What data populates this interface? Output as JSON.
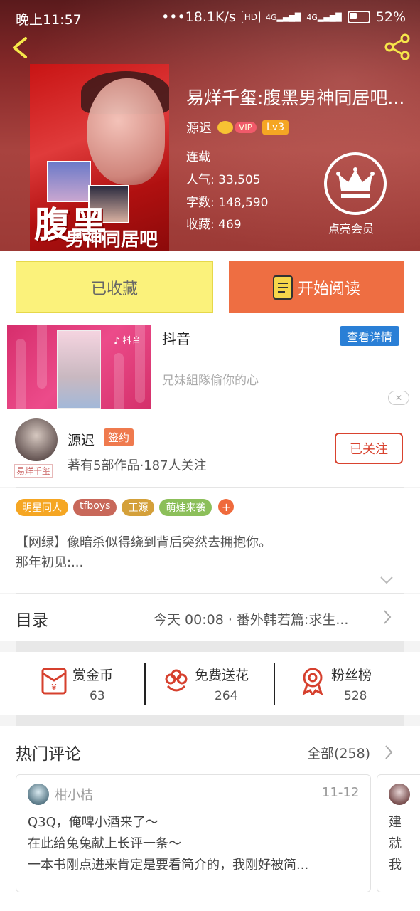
{
  "status_bar": {
    "time": "晚上11:57",
    "network_speed": "•••18.1K/s",
    "hd": "HD",
    "signal1": "4G",
    "signal2": "4G",
    "battery": "52%"
  },
  "book": {
    "title": "易烊千玺:腹黑男神同居吧...",
    "author": "源迟",
    "vip_label": "VIP",
    "level": "Lv3",
    "status": "连载",
    "popularity": "人气: 33,505",
    "word_count": "字数: 148,590",
    "favorites": "收藏: 469",
    "cover_title_main": "腹黑",
    "cover_title_sub": "男神同居吧",
    "vip_member_label": "点亮会员"
  },
  "buttons": {
    "collected": "已收藏",
    "start_reading": "开始阅读"
  },
  "ad": {
    "brand": "抖音",
    "detail_button": "查看详情",
    "description": "兄妹組隊偷你的心",
    "close": "✕"
  },
  "author_section": {
    "name": "源迟",
    "badge": "签约",
    "avatar_tag": "易烊千玺",
    "stats": "著有5部作品·187人关注",
    "follow_button": "已关注"
  },
  "tags": [
    {
      "label": "明星同人",
      "color": "#f5a623"
    },
    {
      "label": "tfboys",
      "color": "#c8685a"
    },
    {
      "label": "王源",
      "color": "#d4a03a"
    },
    {
      "label": "萌娃来袭",
      "color": "#8cbf5a"
    }
  ],
  "tag_more": "+",
  "description": {
    "line1": "【网绿】像暗杀似得绕到背后突然去拥抱你。",
    "line2": "那年初见:..."
  },
  "toc": {
    "title": "目录",
    "latest": "今天 00:08 · 番外韩若篇:求生..."
  },
  "actions": [
    {
      "label": "赏金币",
      "count": "63"
    },
    {
      "label": "免费送花",
      "count": "264"
    },
    {
      "label": "粉丝榜",
      "count": "528"
    }
  ],
  "comments": {
    "header": "热门评论",
    "all_label": "全部(258)",
    "items": [
      {
        "user": "柑小桔",
        "date": "11-12",
        "lines": [
          "Q3Q，俺啤小酒来了～",
          "在此给兔兔献上长评一条～",
          "一本书刚点进来肯定是要看简介的，我刚好被简..."
        ]
      },
      {
        "lines": [
          "建",
          "就",
          "我"
        ]
      }
    ]
  },
  "colors": {
    "accent_orange": "#ee6e42",
    "collected_yellow": "#fbf27b",
    "follow_red": "#d9432f",
    "ad_blue": "#2a7fd6"
  }
}
